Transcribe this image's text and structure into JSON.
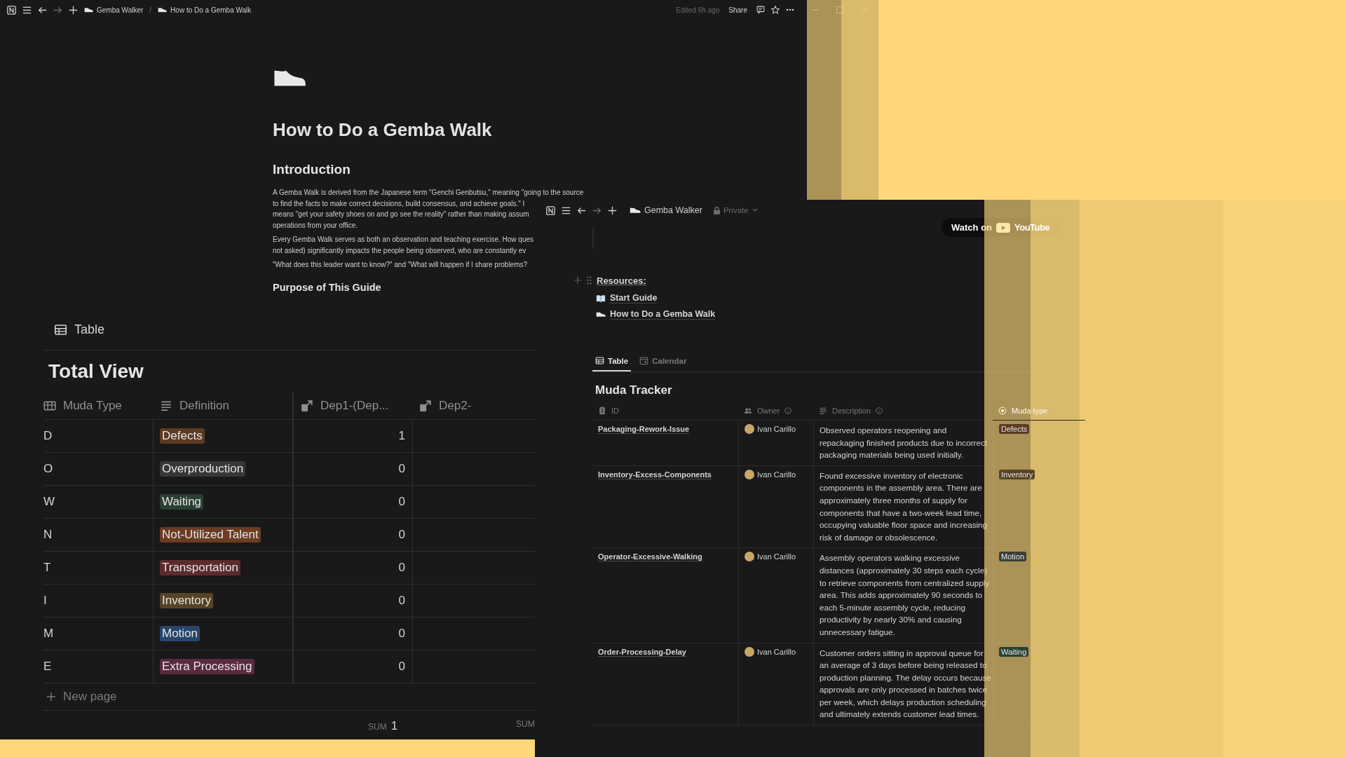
{
  "main_window": {
    "topbar": {
      "separator": "/",
      "breadcrumbs": [
        {
          "label": "Gemba Walker"
        },
        {
          "label": "How to Do a Gemba Walk"
        }
      ],
      "edited": "Edited 6h ago",
      "share": "Share"
    },
    "page": {
      "title": "How to Do a Gemba Walk",
      "heading": "Introduction",
      "paragraphs": [
        [
          "A Gemba Walk is derived from the Japanese term \"Genchi Genbutsu,\" meaning \"going to the source",
          "to find the facts to make correct decisions, build consensus, and achieve goals.\" I",
          "means \"get your safety shoes on and go see the reality\" rather than making assum",
          "operations from your office."
        ],
        [
          "Every Gemba Walk serves as both an observation and teaching exercise. How ques",
          "not asked) significantly impacts the people being observed, who are constantly ev"
        ],
        [
          "\"What does this leader want to know?\" and \"What will happen if I share problems?"
        ]
      ],
      "subheading": "Purpose of This Guide"
    }
  },
  "table_window": {
    "view_tab": "Table",
    "title": "Total View",
    "columns": [
      {
        "label": "Muda Type",
        "kind": "select"
      },
      {
        "label": "Definition",
        "kind": "text"
      },
      {
        "label": "Dep1-(Dep...",
        "kind": "relation"
      },
      {
        "label": "Dep2-",
        "kind": "relation"
      }
    ],
    "rows": [
      {
        "letter": "D",
        "definition": "Defects",
        "color": "#5c3b23",
        "dep1": "1"
      },
      {
        "letter": "O",
        "definition": "Overproduction",
        "color": "#373737",
        "dep1": "0"
      },
      {
        "letter": "W",
        "definition": "Waiting",
        "color": "#2b4034",
        "dep1": "0"
      },
      {
        "letter": "N",
        "definition": "Not-Utilized Talent",
        "color": "#6b3c22",
        "dep1": "0"
      },
      {
        "letter": "T",
        "definition": "Transportation",
        "color": "#5c2b2b",
        "dep1": "0"
      },
      {
        "letter": "I",
        "definition": "Inventory",
        "color": "#574327",
        "dep1": "0"
      },
      {
        "letter": "M",
        "definition": "Motion",
        "color": "#28456c",
        "dep1": "0"
      },
      {
        "letter": "E",
        "definition": "Extra Processing",
        "color": "#5a2a3f",
        "dep1": "0"
      }
    ],
    "new_page": "New page",
    "sums": [
      {
        "label": "SUM",
        "value": "1"
      },
      {
        "label": "SUM"
      }
    ]
  },
  "tracker_window": {
    "topbar": {
      "workspace": "Gemba Walker",
      "privacy": "Private"
    },
    "video_button": {
      "label": "Watch on",
      "logo": "YouTube"
    },
    "resources": {
      "label": "Resources:",
      "links": [
        {
          "label": "Start Guide",
          "kind": "book"
        },
        {
          "label": "How to Do a Gemba Walk",
          "kind": "shoe"
        }
      ]
    },
    "tabs": [
      {
        "label": "Table",
        "kind": "table",
        "selected": true
      },
      {
        "label": "Calendar",
        "kind": "calendar",
        "selected": false
      }
    ],
    "title": "Muda Tracker",
    "columns": [
      {
        "label": "ID",
        "kind": "title"
      },
      {
        "label": "Owner",
        "kind": "person"
      },
      {
        "label": "Description",
        "kind": "text"
      },
      {
        "label": "Muda type",
        "kind": "status"
      }
    ],
    "rows": [
      {
        "id": "Packaging-Rework-Issue",
        "owner": "Ivan Carillo",
        "description": "Observed operators reopening and repackaging finished products due to incorrect packaging materials being used initially.",
        "muda_type": "Defects",
        "color": "#5c3b23"
      },
      {
        "id": "Inventory-Excess-Components",
        "owner": "Ivan Carillo",
        "description": "Found excessive inventory of electronic components in the assembly area. There are approximately three months of supply for components that have a two-week lead time, occupying valuable floor space and increasing risk of damage or obsolescence.",
        "muda_type": "Inventory",
        "color": "#574327"
      },
      {
        "id": "Operator-Excessive-Walking",
        "owner": "Ivan Carillo",
        "description": "Assembly operators walking excessive distances (approximately 30 steps each cycle) to retrieve components from centralized supply area. This adds approximately 90 seconds to each 5-minute assembly cycle, reducing productivity by nearly 30% and causing unnecessary fatigue.",
        "muda_type": "Motion",
        "color": "#3a3f38"
      },
      {
        "id": "Order-Processing-Delay",
        "owner": "Ivan Carillo",
        "description": "Customer orders sitting in approval queue for an average of 3 days before being released to production planning. The delay occurs because approvals are only processed in batches twice per week, which delays production scheduling and ultimately extends customer lead times.",
        "muda_type": "Waiting",
        "color": "#2b4034"
      }
    ]
  }
}
